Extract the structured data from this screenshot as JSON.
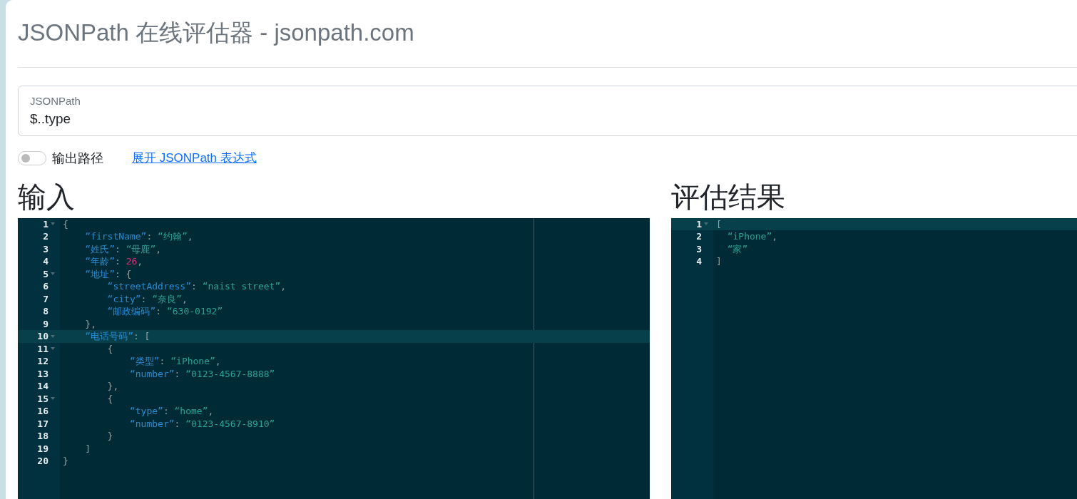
{
  "title": "JSONPath 在线评估器 - jsonpath.com",
  "query": {
    "label": "JSONPath",
    "value": "$..type"
  },
  "output_paths": {
    "label": "输出路径",
    "on": false
  },
  "expand_link": "展开 JSONPath 表达式",
  "input": {
    "heading": "输入",
    "lines": [
      {
        "number": "1",
        "fold": true,
        "active": false,
        "tokens": [
          {
            "kind": "punct",
            "text": "{"
          }
        ]
      },
      {
        "number": "2",
        "fold": false,
        "active": false,
        "tokens": [
          {
            "kind": "key",
            "text": "    “firstName”"
          },
          {
            "kind": "punct",
            "text": ": "
          },
          {
            "kind": "string",
            "text": "“约翰”"
          },
          {
            "kind": "punct",
            "text": ","
          }
        ]
      },
      {
        "number": "3",
        "fold": false,
        "active": false,
        "tokens": [
          {
            "kind": "key",
            "text": "    “姓氏”"
          },
          {
            "kind": "punct",
            "text": ": "
          },
          {
            "kind": "string",
            "text": "“母鹿”"
          },
          {
            "kind": "punct",
            "text": ","
          }
        ]
      },
      {
        "number": "4",
        "fold": false,
        "active": false,
        "tokens": [
          {
            "kind": "key",
            "text": "    “年龄”"
          },
          {
            "kind": "punct",
            "text": ": "
          },
          {
            "kind": "number",
            "text": "26"
          },
          {
            "kind": "punct",
            "text": ","
          }
        ]
      },
      {
        "number": "5",
        "fold": true,
        "active": false,
        "tokens": [
          {
            "kind": "key",
            "text": "    “地址”"
          },
          {
            "kind": "punct",
            "text": ": {"
          }
        ]
      },
      {
        "number": "6",
        "fold": false,
        "active": false,
        "tokens": [
          {
            "kind": "key",
            "text": "        “streetAddress”"
          },
          {
            "kind": "punct",
            "text": ": "
          },
          {
            "kind": "string",
            "text": "“naist street”"
          },
          {
            "kind": "punct",
            "text": ","
          }
        ]
      },
      {
        "number": "7",
        "fold": false,
        "active": false,
        "tokens": [
          {
            "kind": "key",
            "text": "        “city”"
          },
          {
            "kind": "punct",
            "text": ": "
          },
          {
            "kind": "string",
            "text": "“奈良”"
          },
          {
            "kind": "punct",
            "text": ","
          }
        ]
      },
      {
        "number": "8",
        "fold": false,
        "active": false,
        "tokens": [
          {
            "kind": "key",
            "text": "        “邮政编码”"
          },
          {
            "kind": "punct",
            "text": ": "
          },
          {
            "kind": "string",
            "text": "“630-0192”"
          }
        ]
      },
      {
        "number": "9",
        "fold": false,
        "active": false,
        "tokens": [
          {
            "kind": "punct",
            "text": "    },"
          }
        ]
      },
      {
        "number": "10",
        "fold": true,
        "active": true,
        "tokens": [
          {
            "kind": "key",
            "text": "    “电话号码”"
          },
          {
            "kind": "punct",
            "text": ": ["
          }
        ]
      },
      {
        "number": "11",
        "fold": true,
        "active": false,
        "tokens": [
          {
            "kind": "punct",
            "text": "        {"
          }
        ]
      },
      {
        "number": "12",
        "fold": false,
        "active": false,
        "tokens": [
          {
            "kind": "key",
            "text": "            “类型”"
          },
          {
            "kind": "punct",
            "text": ": "
          },
          {
            "kind": "string",
            "text": "“iPhone”"
          },
          {
            "kind": "punct",
            "text": ","
          }
        ]
      },
      {
        "number": "13",
        "fold": false,
        "active": false,
        "tokens": [
          {
            "kind": "key",
            "text": "            “number”"
          },
          {
            "kind": "punct",
            "text": ": "
          },
          {
            "kind": "string",
            "text": "“0123-4567-8888”"
          }
        ]
      },
      {
        "number": "14",
        "fold": false,
        "active": false,
        "tokens": [
          {
            "kind": "punct",
            "text": "        },"
          }
        ]
      },
      {
        "number": "15",
        "fold": true,
        "active": false,
        "tokens": [
          {
            "kind": "punct",
            "text": "        {"
          }
        ]
      },
      {
        "number": "16",
        "fold": false,
        "active": false,
        "tokens": [
          {
            "kind": "key",
            "text": "            “type”"
          },
          {
            "kind": "punct",
            "text": ": "
          },
          {
            "kind": "string",
            "text": "“home”"
          },
          {
            "kind": "punct",
            "text": ","
          }
        ]
      },
      {
        "number": "17",
        "fold": false,
        "active": false,
        "tokens": [
          {
            "kind": "key",
            "text": "            “number”"
          },
          {
            "kind": "punct",
            "text": ": "
          },
          {
            "kind": "string",
            "text": "“0123-4567-8910”"
          }
        ]
      },
      {
        "number": "18",
        "fold": false,
        "active": false,
        "tokens": [
          {
            "kind": "punct",
            "text": "        }"
          }
        ]
      },
      {
        "number": "19",
        "fold": false,
        "active": false,
        "tokens": [
          {
            "kind": "punct",
            "text": "    ]"
          }
        ]
      },
      {
        "number": "20",
        "fold": false,
        "active": false,
        "tokens": [
          {
            "kind": "punct",
            "text": "}"
          }
        ]
      }
    ]
  },
  "result": {
    "heading": "评估结果",
    "lines": [
      {
        "number": "1",
        "fold": true,
        "active": true,
        "tokens": [
          {
            "kind": "punct",
            "text": "["
          }
        ]
      },
      {
        "number": "2",
        "fold": false,
        "active": false,
        "tokens": [
          {
            "kind": "string",
            "text": "  “iPhone”"
          },
          {
            "kind": "punct",
            "text": ","
          }
        ]
      },
      {
        "number": "3",
        "fold": false,
        "active": false,
        "tokens": [
          {
            "kind": "string",
            "text": "  “家”"
          }
        ]
      },
      {
        "number": "4",
        "fold": false,
        "active": false,
        "tokens": [
          {
            "kind": "punct",
            "text": "]"
          }
        ]
      }
    ]
  }
}
